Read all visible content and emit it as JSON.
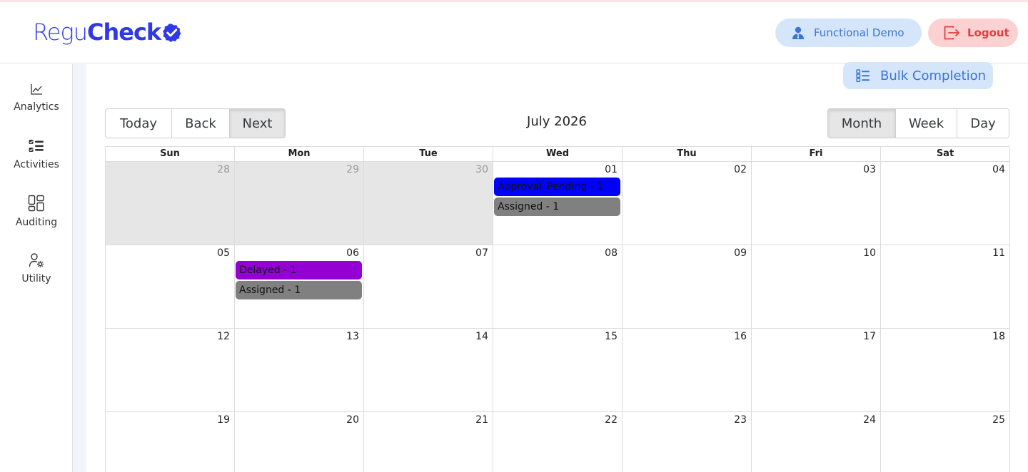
{
  "header": {
    "logo": {
      "part1": "Regu",
      "part2": "Check"
    },
    "user_label": "Functional Demo",
    "logout_label": "Logout"
  },
  "sidebar": {
    "items": [
      {
        "label": "Analytics",
        "icon": "chart-line-icon"
      },
      {
        "label": "Activities",
        "icon": "checklist-icon"
      },
      {
        "label": "Auditing",
        "icon": "dashboard-layout-icon"
      },
      {
        "label": "Utility",
        "icon": "user-gear-icon"
      }
    ]
  },
  "toolbar": {
    "bulk_label": "Bulk Completion",
    "nav": [
      "Today",
      "Back",
      "Next"
    ],
    "active_nav": "Next",
    "month_label": "July 2026",
    "views": [
      "Month",
      "Week",
      "Day"
    ],
    "active_view": "Month"
  },
  "calendar": {
    "weekdays": [
      "Sun",
      "Mon",
      "Tue",
      "Wed",
      "Thu",
      "Fri",
      "Sat"
    ],
    "weeks": [
      [
        {
          "num": "28",
          "off": true,
          "events": []
        },
        {
          "num": "29",
          "off": true,
          "events": []
        },
        {
          "num": "30",
          "off": true,
          "events": []
        },
        {
          "num": "01",
          "off": false,
          "events": [
            {
              "label": "Approval_Pending - 1",
              "color": "#0000ff"
            },
            {
              "label": "Assigned - 1",
              "color": "#808080"
            }
          ]
        },
        {
          "num": "02",
          "off": false,
          "events": []
        },
        {
          "num": "03",
          "off": false,
          "events": []
        },
        {
          "num": "04",
          "off": false,
          "events": []
        }
      ],
      [
        {
          "num": "05",
          "off": false,
          "events": []
        },
        {
          "num": "06",
          "off": false,
          "events": [
            {
              "label": "Delayed - 1",
              "color": "#9400d3"
            },
            {
              "label": "Assigned - 1",
              "color": "#808080"
            }
          ]
        },
        {
          "num": "07",
          "off": false,
          "events": []
        },
        {
          "num": "08",
          "off": false,
          "events": []
        },
        {
          "num": "09",
          "off": false,
          "events": []
        },
        {
          "num": "10",
          "off": false,
          "events": []
        },
        {
          "num": "11",
          "off": false,
          "events": []
        }
      ],
      [
        {
          "num": "12",
          "off": false,
          "events": []
        },
        {
          "num": "13",
          "off": false,
          "events": []
        },
        {
          "num": "14",
          "off": false,
          "events": []
        },
        {
          "num": "15",
          "off": false,
          "events": []
        },
        {
          "num": "16",
          "off": false,
          "events": []
        },
        {
          "num": "17",
          "off": false,
          "events": []
        },
        {
          "num": "18",
          "off": false,
          "events": []
        }
      ],
      [
        {
          "num": "19",
          "off": false,
          "events": []
        },
        {
          "num": "20",
          "off": false,
          "events": []
        },
        {
          "num": "21",
          "off": false,
          "events": []
        },
        {
          "num": "22",
          "off": false,
          "events": []
        },
        {
          "num": "23",
          "off": false,
          "events": []
        },
        {
          "num": "24",
          "off": false,
          "events": []
        },
        {
          "num": "25",
          "off": false,
          "events": []
        }
      ]
    ]
  },
  "colors": {
    "brand": "#2f39e8",
    "pill_blue": "#d5e6fb",
    "pill_blue_text": "#3b75d8",
    "logout_bg": "#fcd1d1",
    "logout_text": "#e63c3c",
    "off_range_bg": "#e6e6e6"
  }
}
